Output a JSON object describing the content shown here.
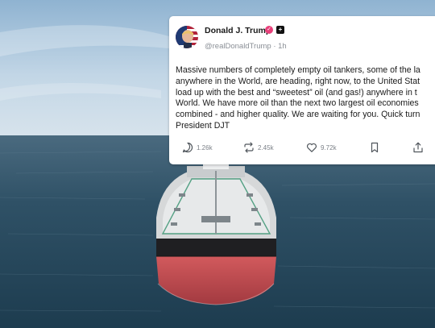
{
  "post": {
    "author_name": "Donald J. Trump",
    "verified_icon": "verified-badge-icon",
    "tag_icon": "plus-tag-icon",
    "handle": "@realDonaldTrump",
    "time": "1h",
    "text": "Massive numbers of completely empty oil tankers, some of the la\nanywhere in the World, are heading, right now, to the United Stat\nload up with the best and “sweetest” oil (and gas!) anywhere in t\nWorld. We have more oil than the next two largest oil economies\ncombined - and higher quality. We are waiting for you. Quick turn\nPresident DJT",
    "actions": {
      "replies": "1.26k",
      "reposts": "2.45k",
      "likes": "9.72k"
    }
  },
  "colors": {
    "card_bg": "#ffffff",
    "badge": "#e8407a",
    "muted_text": "#7c8188",
    "ship_hull_red": "#c64a4e",
    "sea": "#27465a",
    "sky": "#b9d0e2"
  },
  "icons": [
    "reply-icon",
    "repost-icon",
    "like-icon",
    "bookmark-icon",
    "share-icon"
  ]
}
